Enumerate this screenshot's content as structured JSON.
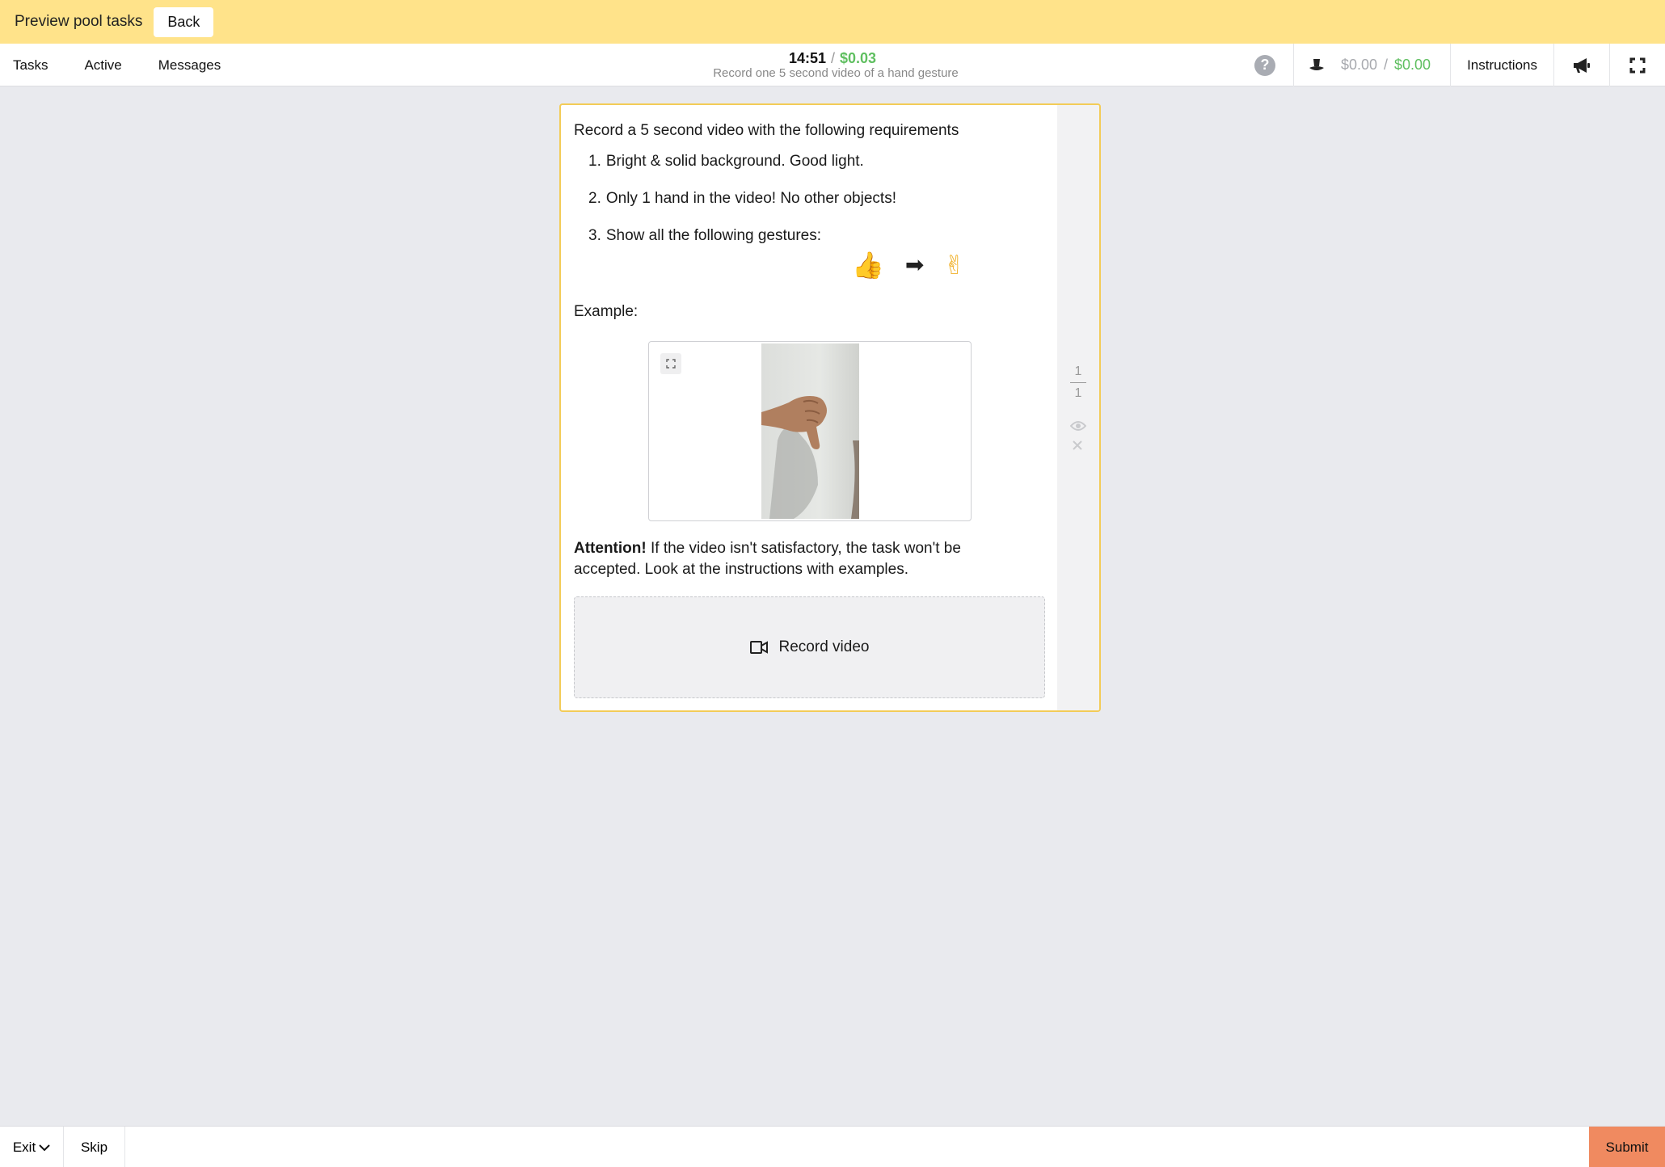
{
  "preview": {
    "title": "Preview pool tasks",
    "back_label": "Back"
  },
  "nav": {
    "tasks": "Tasks",
    "active": "Active",
    "messages": "Messages"
  },
  "status": {
    "timer": "14:51",
    "separator": "/",
    "reward": "$0.03",
    "task_title": "Record one 5 second video of a hand gesture"
  },
  "tools": {
    "help_icon": "question-circle-icon",
    "balance_icon": "hat-icon",
    "balance_current": "$0.00",
    "balance_separator": "/",
    "balance_total": "$0.00",
    "instructions_label": "Instructions",
    "announce_icon": "megaphone-icon",
    "fullscreen_icon": "fullscreen-icon"
  },
  "task": {
    "heading": "Record a 5 second video with the following requirements",
    "requirements": [
      {
        "num": "1.",
        "text": "Bright & solid background. Good light."
      },
      {
        "num": "2.",
        "text": "Only 1 hand in the video! No other objects!"
      },
      {
        "num": "3.",
        "text": "Show all the following gestures:"
      }
    ],
    "gestures": {
      "first": "👍",
      "arrow": "➡",
      "second": "✌"
    },
    "example_label": "Example:",
    "attention_label": "Attention!",
    "attention_text": " If the video isn't satisfactory, the task won't be accepted. Look at the instructions with examples.",
    "record_label": "Record video"
  },
  "counter": {
    "current": "1",
    "total": "1"
  },
  "bottom": {
    "exit_label": "Exit",
    "skip_label": "Skip",
    "submit_label": "Submit"
  },
  "colors": {
    "accent_yellow": "#ffe38a",
    "reward_green": "#5fbf60",
    "submit_orange": "#f08a60",
    "card_border": "#f3cc57"
  }
}
